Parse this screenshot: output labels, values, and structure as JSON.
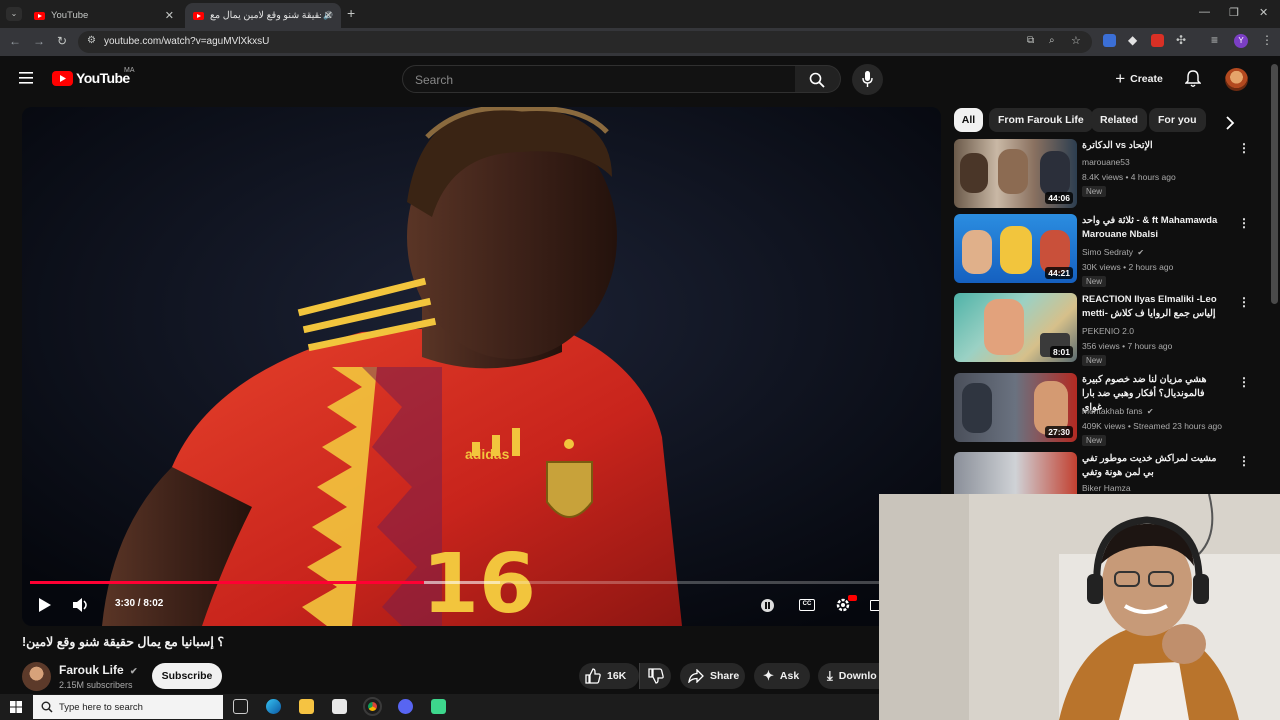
{
  "browser": {
    "tabs": [
      {
        "label": "YouTube"
      },
      {
        "label": "‏حقيقة شنو وقع لامين يمال مع"
      }
    ],
    "url": "youtube.com/watch?v=aguMVlXkxsU"
  },
  "header": {
    "logo_text": "YouTube",
    "region": "MA",
    "search_placeholder": "Search",
    "create_label": "Create"
  },
  "player": {
    "time": "3:30 / 8:02",
    "progress_fraction": 0.436,
    "buffer_fraction": 0.52
  },
  "video": {
    "title": "!؟ إسبانيا مع يمال حقيقة شنو وقع لامين",
    "channel": "Farouk Life",
    "subscribers": "2.15M subscribers",
    "subscribe_label": "Subscribe",
    "like_count": "16K",
    "share_label": "Share",
    "ask_label": "Ask",
    "download_label": "Downlo"
  },
  "chips": [
    "All",
    "From Farouk Life",
    "Related",
    "For you"
  ],
  "suggested": [
    {
      "title": "الإتحاد vs الدكاترة",
      "channel": "marouane53",
      "meta": "8.4K views • 4 hours ago",
      "badge": "New",
      "duration": "44:06",
      "verified": false
    },
    {
      "title": "ثلاثة في واحد - & ft Mahamawda Marouane Nbalsi",
      "channel": "Simo Sedraty",
      "meta": "30K views • 2 hours ago",
      "badge": "New",
      "duration": "44:21",
      "verified": true
    },
    {
      "title": "REACTION Ilyas Elmaliki -Leo metti- إلياس جمع الروايا ف كلاش",
      "channel": "PEKENIO 2.0",
      "meta": "356 views • 7 hours ago",
      "badge": "New",
      "duration": "8:01",
      "verified": false
    },
    {
      "title": "هشي مزيان لنا ضد خصوم كبيرة فالمونديال؟ أفكار وهبي ضد بارا غواي",
      "channel": "montakhab fans",
      "meta": "409K views • Streamed 23 hours ago",
      "badge": "New",
      "duration": "27:30",
      "verified": true
    },
    {
      "title": "مشيت لمراكش خديت موطور تفي بي لمن هونة وتفي",
      "channel": "Biker Hamza",
      "meta": "",
      "badge": "",
      "duration": "",
      "verified": false
    }
  ],
  "taskbar": {
    "search_placeholder": "Type here to search"
  }
}
